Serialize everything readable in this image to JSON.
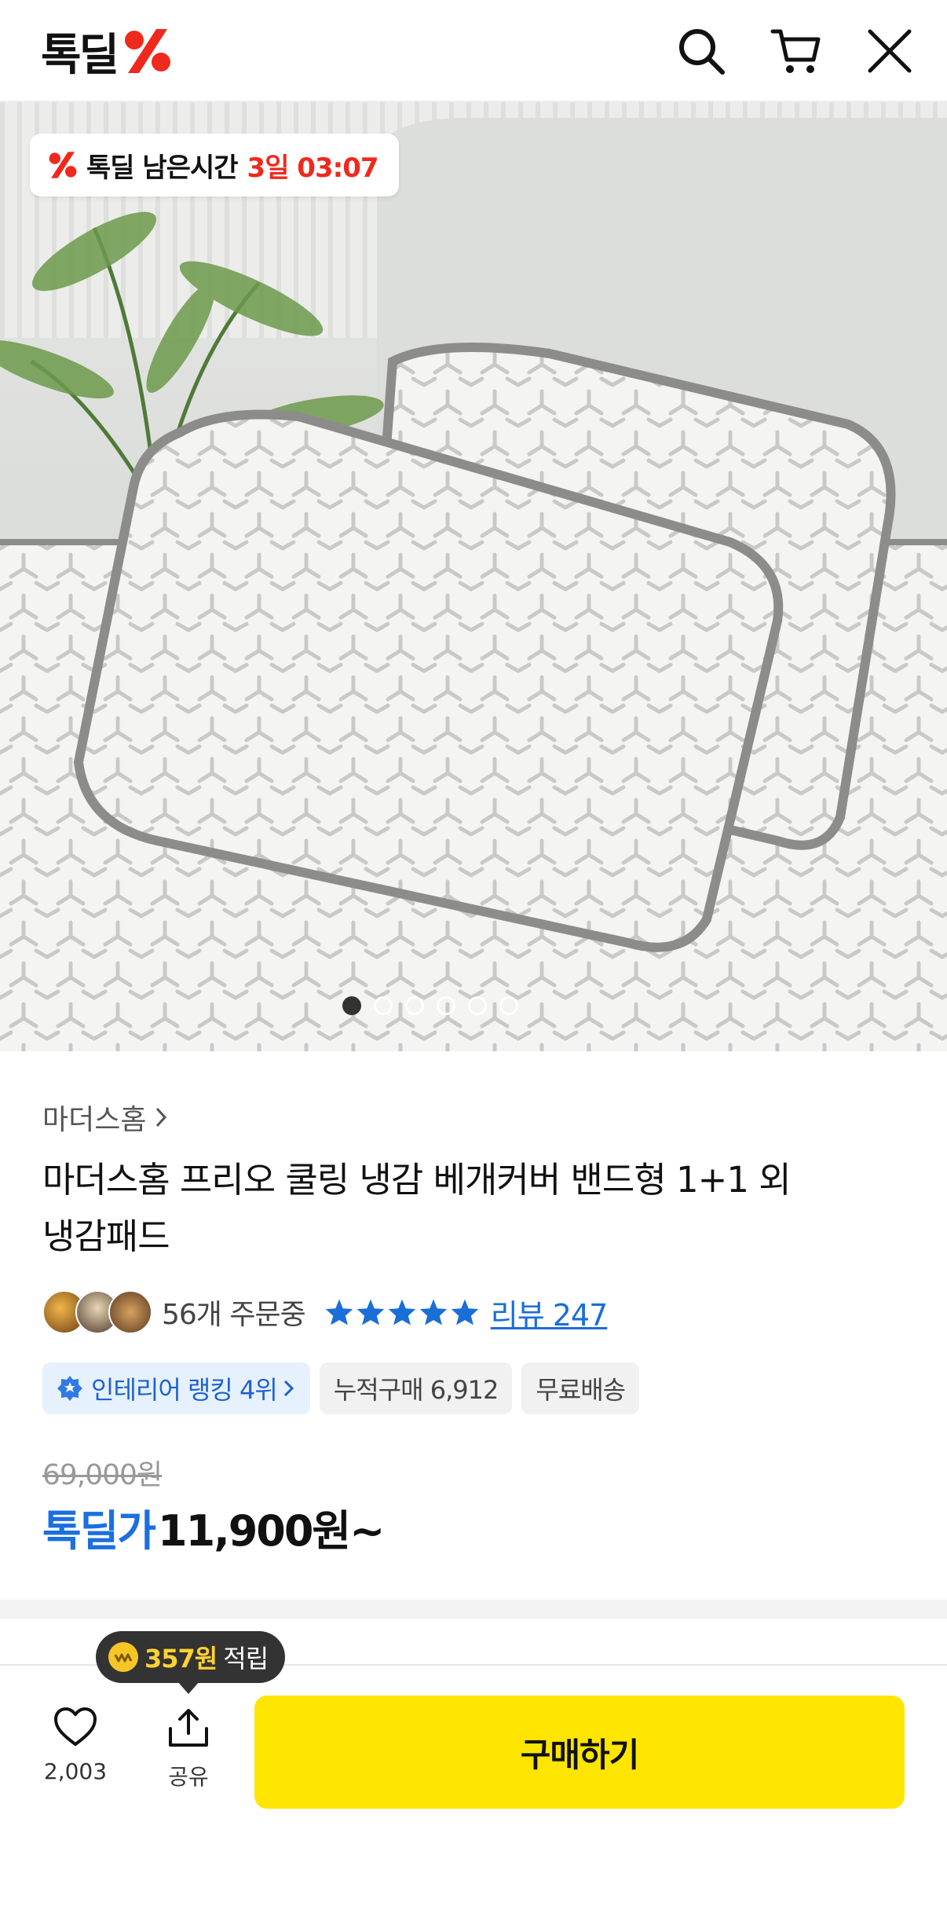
{
  "header": {
    "logo_text": "톡딜",
    "logo_icon": "percent-bolt-icon",
    "icons": [
      "search-icon",
      "cart-icon",
      "close-icon"
    ]
  },
  "hero": {
    "timer_label": "톡딜 남은시간",
    "timer_value": "3일 03:07",
    "slide_count": 6,
    "active_slide": 1
  },
  "product": {
    "brand": "마더스홈",
    "title_line1": "마더스홈 프리오 쿨링 냉감 베개커버 밴드형 1+1 외",
    "title_line2": "냉감패드",
    "orders": "56개 주문중",
    "rating_stars": 5,
    "review_label": "리뷰 247",
    "tags": {
      "rank": "인테리어 랭킹 4위",
      "cumulative": "누적구매 6,912",
      "shipping": "무료배송"
    },
    "original_price": "69,000원",
    "price_label": "톡딜가",
    "price": "11,900원~"
  },
  "bottom": {
    "points_amount": "357원",
    "points_text": "적립",
    "like_count": "2,003",
    "share_label": "공유",
    "buy_label": "구매하기"
  },
  "colors": {
    "accent_red": "#f0291d",
    "accent_blue": "#1b6fe0",
    "buy_yellow": "#fee500"
  }
}
